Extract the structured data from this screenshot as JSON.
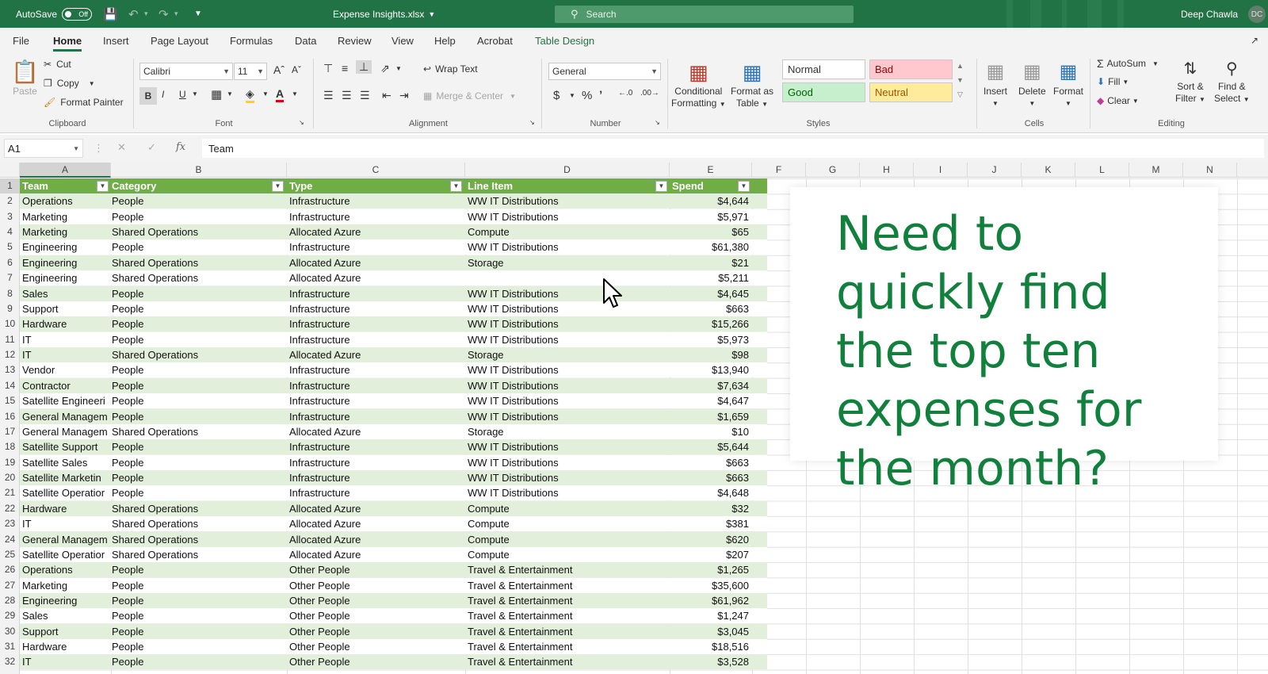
{
  "titlebar": {
    "autosave_label": "AutoSave",
    "autosave_state": "Off",
    "filename": "Expense Insights.xlsx",
    "search_placeholder": "Search",
    "user_name": "Deep Chawla",
    "user_initials": "DC"
  },
  "menu": {
    "tabs": [
      "File",
      "Home",
      "Insert",
      "Page Layout",
      "Formulas",
      "Data",
      "Review",
      "View",
      "Help",
      "Acrobat",
      "Table Design"
    ]
  },
  "ribbon": {
    "clipboard": {
      "label": "Clipboard",
      "paste": "Paste",
      "cut": "Cut",
      "copy": "Copy",
      "format_painter": "Format Painter"
    },
    "font": {
      "label": "Font",
      "name": "Calibri",
      "size": "11"
    },
    "alignment": {
      "label": "Alignment",
      "wrap_text": "Wrap Text",
      "merge_center": "Merge & Center"
    },
    "number": {
      "label": "Number",
      "format": "General"
    },
    "styles": {
      "label": "Styles",
      "conditional": "Conditional",
      "conditional2": "Formatting",
      "format_as": "Format as",
      "format_as2": "Table",
      "normal": "Normal",
      "bad": "Bad",
      "good": "Good",
      "neutral": "Neutral"
    },
    "cells": {
      "label": "Cells",
      "insert": "Insert",
      "delete": "Delete",
      "format": "Format"
    },
    "editing": {
      "label": "Editing",
      "autosum": "AutoSum",
      "fill": "Fill",
      "clear": "Clear",
      "sort": "Sort &",
      "sort2": "Filter",
      "find": "Find &",
      "find2": "Select"
    }
  },
  "formula": {
    "cell_ref": "A1",
    "content": "Team"
  },
  "columns": [
    "A",
    "B",
    "C",
    "D",
    "E",
    "F",
    "G",
    "H",
    "I",
    "J",
    "K",
    "L",
    "M",
    "N"
  ],
  "rows": [
    "1",
    "2",
    "3",
    "4",
    "5",
    "6",
    "7",
    "8",
    "9",
    "10",
    "11",
    "12",
    "13",
    "14",
    "15",
    "16",
    "17",
    "18",
    "19",
    "20",
    "21",
    "22",
    "23",
    "24",
    "25",
    "26",
    "27",
    "28",
    "29",
    "30",
    "31",
    "32"
  ],
  "table": {
    "headers": [
      "Team",
      "Category",
      "Type",
      "Line Item",
      "Spend"
    ],
    "rows": [
      [
        "Operations",
        "People",
        "Infrastructure",
        "WW IT Distributions",
        "$4,644"
      ],
      [
        "Marketing",
        "People",
        "Infrastructure",
        "WW IT Distributions",
        "$5,971"
      ],
      [
        "Marketing",
        "Shared Operations",
        "Allocated Azure",
        "Compute",
        "$65"
      ],
      [
        "Engineering",
        "People",
        "Infrastructure",
        "WW IT Distributions",
        "$61,380"
      ],
      [
        "Engineering",
        "Shared Operations",
        "Allocated Azure",
        "Storage",
        "$21"
      ],
      [
        "Engineering",
        "Shared Operations",
        "Allocated Azure",
        "",
        "$5,211"
      ],
      [
        "Sales",
        "People",
        "Infrastructure",
        "WW IT Distributions",
        "$4,645"
      ],
      [
        "Support",
        "People",
        "Infrastructure",
        "WW IT Distributions",
        "$663"
      ],
      [
        "Hardware",
        "People",
        "Infrastructure",
        "WW IT Distributions",
        "$15,266"
      ],
      [
        "IT",
        "People",
        "Infrastructure",
        "WW IT Distributions",
        "$5,973"
      ],
      [
        "IT",
        "Shared Operations",
        "Allocated Azure",
        "Storage",
        "$98"
      ],
      [
        "Vendor",
        "People",
        "Infrastructure",
        "WW IT Distributions",
        "$13,940"
      ],
      [
        "Contractor",
        "People",
        "Infrastructure",
        "WW IT Distributions",
        "$7,634"
      ],
      [
        "Satellite Engineeri",
        "People",
        "Infrastructure",
        "WW IT Distributions",
        "$4,647"
      ],
      [
        "General Managem",
        "People",
        "Infrastructure",
        "WW IT Distributions",
        "$1,659"
      ],
      [
        "General Managem",
        "Shared Operations",
        "Allocated Azure",
        "Storage",
        "$10"
      ],
      [
        "Satellite Support",
        "People",
        "Infrastructure",
        "WW IT Distributions",
        "$5,644"
      ],
      [
        "Satellite Sales",
        "People",
        "Infrastructure",
        "WW IT Distributions",
        "$663"
      ],
      [
        "Satellite Marketin",
        "People",
        "Infrastructure",
        "WW IT Distributions",
        "$663"
      ],
      [
        "Satellite Operatior",
        "People",
        "Infrastructure",
        "WW IT Distributions",
        "$4,648"
      ],
      [
        "Hardware",
        "Shared Operations",
        "Allocated Azure",
        "Compute",
        "$32"
      ],
      [
        "IT",
        "Shared Operations",
        "Allocated Azure",
        "Compute",
        "$381"
      ],
      [
        "General Managem",
        "Shared Operations",
        "Allocated Azure",
        "Compute",
        "$620"
      ],
      [
        "Satellite Operatior",
        "Shared Operations",
        "Allocated Azure",
        "Compute",
        "$207"
      ],
      [
        "Operations",
        "People",
        "Other People",
        "Travel & Entertainment",
        "$1,265"
      ],
      [
        "Marketing",
        "People",
        "Other People",
        "Travel & Entertainment",
        "$35,600"
      ],
      [
        "Engineering",
        "People",
        "Other People",
        "Travel & Entertainment",
        "$61,962"
      ],
      [
        "Sales",
        "People",
        "Other People",
        "Travel & Entertainment",
        "$1,247"
      ],
      [
        "Support",
        "People",
        "Other People",
        "Travel & Entertainment",
        "$3,045"
      ],
      [
        "Hardware",
        "People",
        "Other People",
        "Travel & Entertainment",
        "$18,516"
      ],
      [
        "IT",
        "People",
        "Other People",
        "Travel & Entertainment",
        "$3,528"
      ]
    ]
  },
  "callout": {
    "text": "Need to quickly find the top ten expenses for the month?"
  },
  "colors": {
    "accent": "#217346",
    "table_header": "#70ad47",
    "band": "#e2efda",
    "callout_text": "#12803d"
  }
}
